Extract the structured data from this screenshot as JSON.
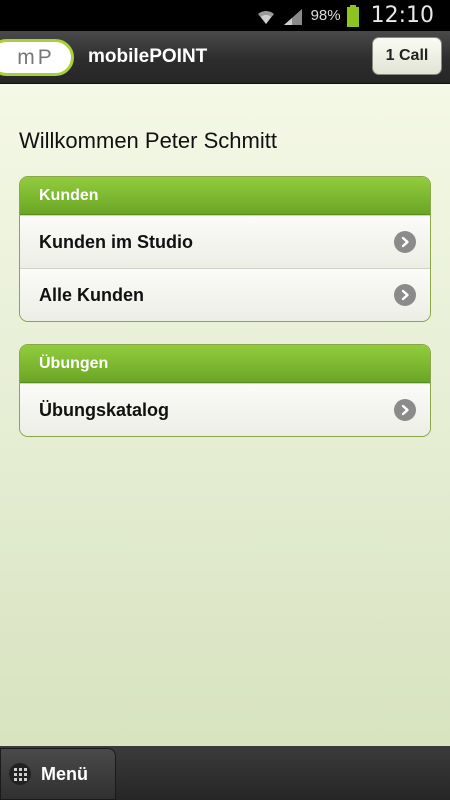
{
  "statusbar": {
    "battery_pct": "98%",
    "time": "12:10",
    "icons": [
      "wifi-icon",
      "signal-icon",
      "battery-icon"
    ]
  },
  "header": {
    "logo_text": "mP",
    "title": "mobilePOINT",
    "call_label": "1 Call"
  },
  "main": {
    "welcome": "Willkommen Peter Schmitt",
    "groups": [
      {
        "header": "Kunden",
        "items": [
          {
            "label": "Kunden im Studio"
          },
          {
            "label": "Alle Kunden"
          }
        ]
      },
      {
        "header": "Übungen",
        "items": [
          {
            "label": "Übungskatalog"
          }
        ]
      }
    ]
  },
  "bottom": {
    "menu_label": "Menü"
  },
  "colors": {
    "accent_green": "#7ab82e",
    "logo_ring": "#a9cf3a",
    "titlebar": "#2d2d2d"
  }
}
